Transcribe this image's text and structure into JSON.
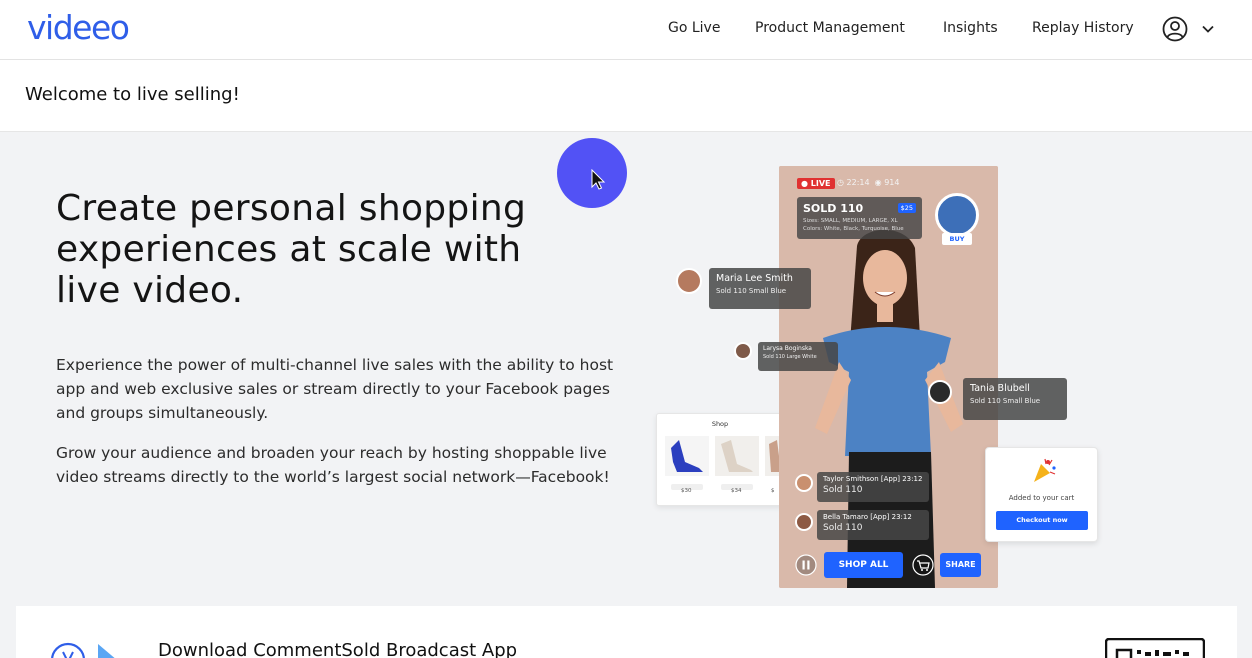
{
  "header": {
    "logo_text": "videeo",
    "nav": [
      "Go Live",
      "Product Management",
      "Insights",
      "Replay History"
    ],
    "account_icon": "user-circle-icon",
    "menu_icon": "chevron-down-icon"
  },
  "welcome": {
    "title": "Welcome to live selling!"
  },
  "hero": {
    "headline": "Create personal shopping experiences at scale with live video.",
    "para1": "Experience the power of multi-channel live sales with the ability to host app and web exclusive sales or stream directly to your Facebook pages and groups simultaneously.",
    "para2": "Grow your audience and broaden your reach by hosting shoppable live video streams directly to the world’s largest social network—Facebook!"
  },
  "mockup": {
    "live_label": "LIVE",
    "live_time": "22:14",
    "live_viewers": "914",
    "sold_title": "SOLD 110",
    "sold_price": "$25",
    "sold_sizes": "Sizes: SMALL, MEDIUM, LARGE, XL",
    "sold_colors": "Colors: White, Black, Turquoise, Blue",
    "buy_label": "BUY",
    "comments": [
      {
        "name": "Maria Lee Smith",
        "detail": "Sold 110 Small Blue"
      },
      {
        "name": "Larysa Boginska",
        "detail": "Sold 110 Large White"
      },
      {
        "name": "Tania Blubell",
        "detail": "Sold 110 Small Blue"
      },
      {
        "name": "Taylor Smithson [App] 23:12",
        "detail": "Sold 110"
      },
      {
        "name": "Bella Tamaro [App] 23:12",
        "detail": "Sold 110"
      }
    ],
    "shop_all_label": "SHOP ALL",
    "share_label": "SHARE",
    "shop_card_title": "Shop",
    "shop_prices": [
      "$30",
      "$34",
      "$"
    ],
    "cart_message": "Added to your cart",
    "checkout_label": "Checkout now"
  },
  "download": {
    "title": "Download CommentSold Broadcast App"
  },
  "colors": {
    "brand_blue": "#2f5ee8",
    "accent_blue": "#1f63ff",
    "cursor": "#5252f5"
  }
}
